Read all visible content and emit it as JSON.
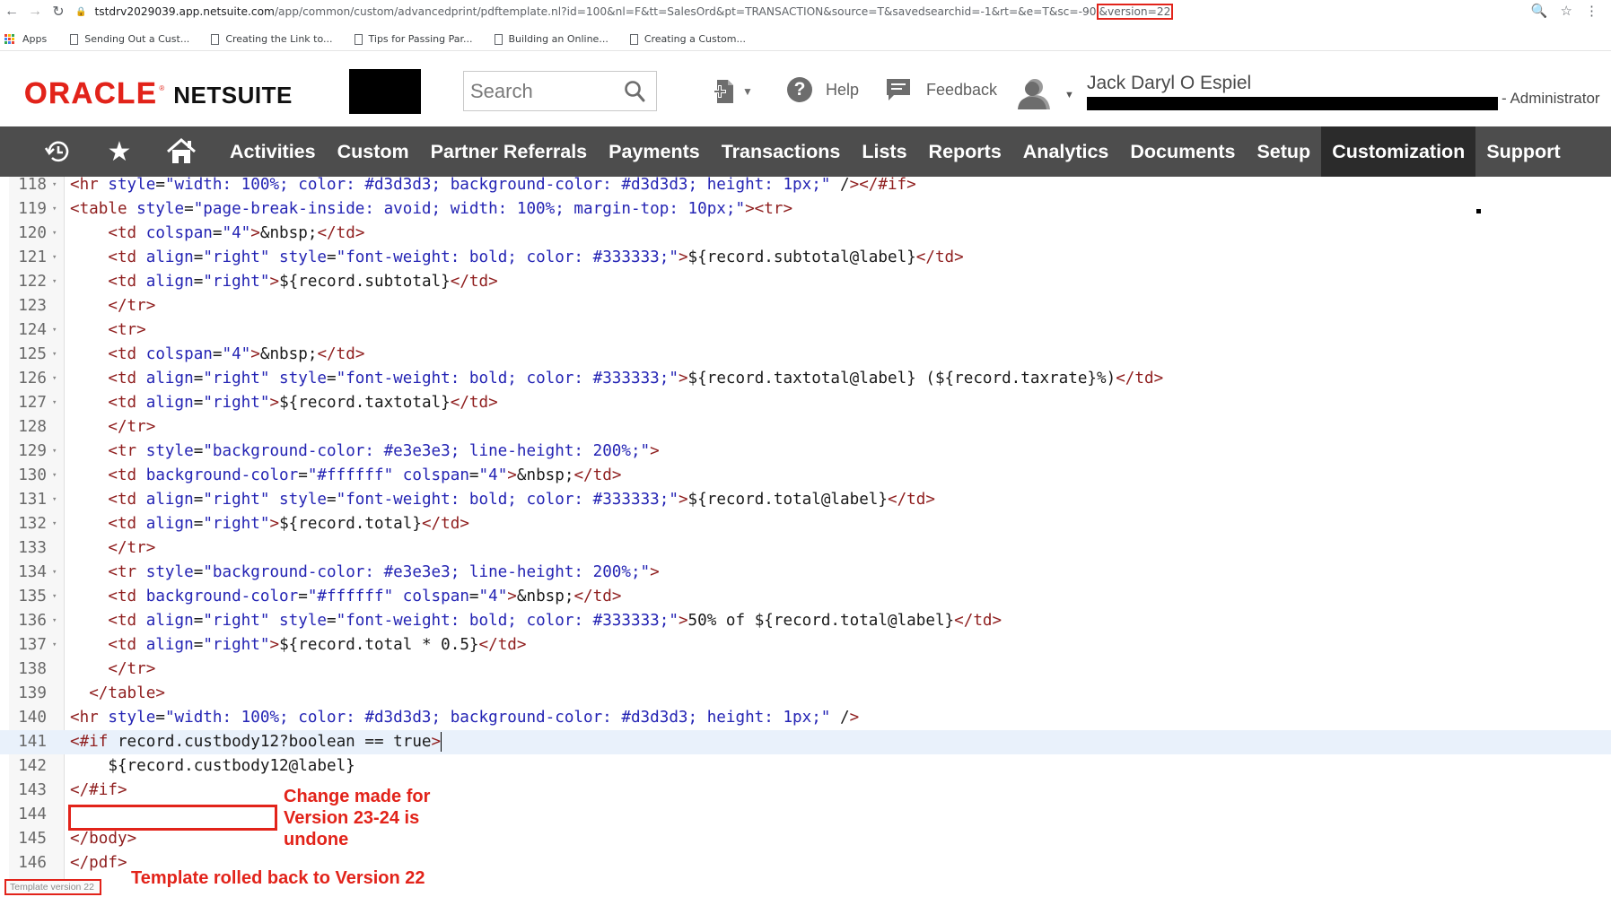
{
  "browser": {
    "url_domain": "tstdrv2029039.app.netsuite.com",
    "url_path": "/app/common/custom/advancedprint/pdftemplate.nl?id=100&nl=F&tt=SalesOrd&pt=TRANSACTION&source=T&savedsearchid=-1&rt=&e=T&sc=-90",
    "url_version": "&version=22",
    "bookmarks": [
      "Apps",
      "Sending Out a Cust...",
      "Creating the Link to...",
      "Tips for Passing Par...",
      "Building an Online...",
      "Creating a Custom..."
    ]
  },
  "header": {
    "logo_oracle": "ORACLE",
    "logo_reg": "®",
    "logo_netsuite": "NETSUITE",
    "search_placeholder": "Search",
    "help_label": "Help",
    "feedback_label": "Feedback",
    "user_name": "Jack Daryl O Espiel",
    "user_role": "- Administrator"
  },
  "nav": {
    "items": [
      "Activities",
      "Custom",
      "Partner Referrals",
      "Payments",
      "Transactions",
      "Lists",
      "Reports",
      "Analytics",
      "Documents",
      "Setup",
      "Customization",
      "Support"
    ],
    "active": "Customization"
  },
  "editor": {
    "lines": [
      {
        "n": "118",
        "fold": true,
        "text": "<hr style=\"width: 100%; color: #d3d3d3; background-color: #d3d3d3; height: 1px;\" /></#if>"
      },
      {
        "n": "119",
        "fold": true,
        "text": "<table style=\"page-break-inside: avoid; width: 100%; margin-top: 10px;\"><tr>"
      },
      {
        "n": "120",
        "fold": true,
        "text": "    <td colspan=\"4\">&nbsp;</td>"
      },
      {
        "n": "121",
        "fold": true,
        "text": "    <td align=\"right\" style=\"font-weight: bold; color: #333333;\">${record.subtotal@label}</td>"
      },
      {
        "n": "122",
        "fold": true,
        "text": "    <td align=\"right\">${record.subtotal}</td>"
      },
      {
        "n": "123",
        "fold": false,
        "text": "    </tr>"
      },
      {
        "n": "124",
        "fold": true,
        "text": "    <tr>"
      },
      {
        "n": "125",
        "fold": true,
        "text": "    <td colspan=\"4\">&nbsp;</td>"
      },
      {
        "n": "126",
        "fold": true,
        "text": "    <td align=\"right\" style=\"font-weight: bold; color: #333333;\">${record.taxtotal@label} (${record.taxrate}%)</td>"
      },
      {
        "n": "127",
        "fold": true,
        "text": "    <td align=\"right\">${record.taxtotal}</td>"
      },
      {
        "n": "128",
        "fold": false,
        "text": "    </tr>"
      },
      {
        "n": "129",
        "fold": true,
        "text": "    <tr style=\"background-color: #e3e3e3; line-height: 200%;\">"
      },
      {
        "n": "130",
        "fold": true,
        "text": "    <td background-color=\"#ffffff\" colspan=\"4\">&nbsp;</td>"
      },
      {
        "n": "131",
        "fold": true,
        "text": "    <td align=\"right\" style=\"font-weight: bold; color: #333333;\">${record.total@label}</td>"
      },
      {
        "n": "132",
        "fold": true,
        "text": "    <td align=\"right\">${record.total}</td>"
      },
      {
        "n": "133",
        "fold": false,
        "text": "    </tr>"
      },
      {
        "n": "134",
        "fold": true,
        "text": "    <tr style=\"background-color: #e3e3e3; line-height: 200%;\">"
      },
      {
        "n": "135",
        "fold": true,
        "text": "    <td background-color=\"#ffffff\" colspan=\"4\">&nbsp;</td>"
      },
      {
        "n": "136",
        "fold": true,
        "text": "    <td align=\"right\" style=\"font-weight: bold; color: #333333;\">50% of ${record.total@label}</td>"
      },
      {
        "n": "137",
        "fold": true,
        "text": "    <td align=\"right\">${record.total * 0.5}</td>"
      },
      {
        "n": "138",
        "fold": false,
        "text": "    </tr>"
      },
      {
        "n": "139",
        "fold": false,
        "text": "  </table>"
      },
      {
        "n": "140",
        "fold": false,
        "text": "<hr style=\"width: 100%; color: #d3d3d3; background-color: #d3d3d3; height: 1px;\" />"
      },
      {
        "n": "141",
        "fold": false,
        "text": "<#if record.custbody12?boolean == true>",
        "highlight": true
      },
      {
        "n": "142",
        "fold": false,
        "text": "    ${record.custbody12@label}"
      },
      {
        "n": "143",
        "fold": false,
        "text": "</#if>"
      },
      {
        "n": "144",
        "fold": false,
        "text": ""
      },
      {
        "n": "145",
        "fold": false,
        "text": "</body>"
      },
      {
        "n": "146",
        "fold": false,
        "text": "</pdf>"
      }
    ]
  },
  "annotations": {
    "change_note": "Change made for Version 23-24 is undone",
    "rollback_note": "Template rolled back to Version 22",
    "template_version": "Template version 22"
  },
  "colors": {
    "oracle_red": "#e2231a",
    "navbar_bg": "#4d4d4d",
    "navbar_active_bg": "#2b2b2b",
    "annotation_red": "#e2231a"
  }
}
